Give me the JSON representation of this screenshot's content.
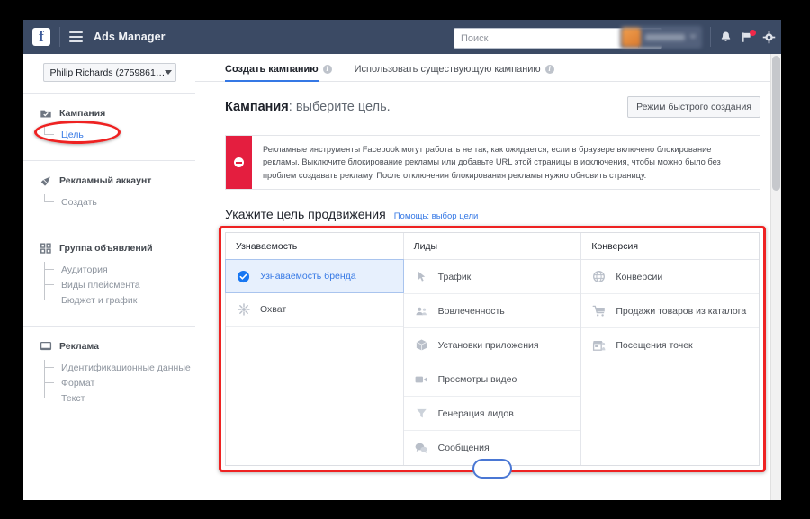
{
  "topbar": {
    "logo": "f",
    "menu_icon": "hamburger-icon",
    "app_title": "Ads Manager",
    "search": {
      "placeholder": "Поиск",
      "value": "",
      "icon": "search-icon"
    },
    "icons": [
      "bell-icon",
      "flag-icon",
      "gear-icon"
    ]
  },
  "sidebar": {
    "account_selector": {
      "label": "Philip Richards (2759861…",
      "icon": "chevron-down-icon"
    },
    "groups": [
      {
        "icon": "campaign-icon",
        "label": "Кампания",
        "items": [
          {
            "label": "Цель",
            "active": true,
            "highlighted": true
          }
        ]
      },
      {
        "icon": "megaphone-icon",
        "label": "Рекламный аккаунт",
        "items": [
          {
            "label": "Создать",
            "active": false,
            "highlighted": false
          }
        ]
      },
      {
        "icon": "adset-grid-icon",
        "label": "Группа объявлений",
        "items": [
          {
            "label": "Аудитория",
            "active": false,
            "highlighted": false
          },
          {
            "label": "Виды плейсмента",
            "active": false,
            "highlighted": false
          },
          {
            "label": "Бюджет и график",
            "active": false,
            "highlighted": false
          }
        ]
      },
      {
        "icon": "ad-monitor-icon",
        "label": "Реклама",
        "items": [
          {
            "label": "Идентификационные данные",
            "active": false,
            "highlighted": false
          },
          {
            "label": "Формат",
            "active": false,
            "highlighted": false
          },
          {
            "label": "Текст",
            "active": false,
            "highlighted": false
          }
        ]
      }
    ]
  },
  "main": {
    "tabs": [
      {
        "label": "Создать кампанию",
        "active": true,
        "info": "info-icon"
      },
      {
        "label": "Использовать существующую кампанию",
        "active": false,
        "info": "info-icon"
      }
    ],
    "heading": {
      "strong": "Кампания",
      "rest": ": выберите цель."
    },
    "quick_create_button": "Режим быстрого создания",
    "alert": {
      "icon": "error-circle-icon",
      "text": "Рекламные инструменты Facebook могут работать не так, как ожидается, если в браузере включено блокирование рекламы. Выключите блокирование рекламы или добавьте URL этой страницы в исключения, чтобы можно было без проблем создавать рекламу. После отключения блокирования рекламы нужно обновить страницу."
    },
    "section": {
      "title": "Укажите цель продвижения",
      "help_link": "Помощь: выбор цели"
    },
    "objectives": [
      {
        "header": "Узнаваемость",
        "items": [
          {
            "label": "Узнаваемость бренда",
            "icon": "check-circle-icon",
            "selected": true
          },
          {
            "label": "Охват",
            "icon": "reach-burst-icon",
            "selected": false
          }
        ]
      },
      {
        "header": "Лиды",
        "items": [
          {
            "label": "Трафик",
            "icon": "cursor-icon",
            "selected": false
          },
          {
            "label": "Вовлеченность",
            "icon": "people-icon",
            "selected": false
          },
          {
            "label": "Установки приложения",
            "icon": "cube-icon",
            "selected": false
          },
          {
            "label": "Просмотры видео",
            "icon": "video-camera-icon",
            "selected": false
          },
          {
            "label": "Генерация лидов",
            "icon": "funnel-icon",
            "selected": false
          },
          {
            "label": "Сообщения",
            "icon": "chat-bubbles-icon",
            "selected": false
          }
        ]
      },
      {
        "header": "Конверсия",
        "items": [
          {
            "label": "Конверсии",
            "icon": "globe-icon",
            "selected": false
          },
          {
            "label": "Продажи товаров из каталога",
            "icon": "shopping-cart-icon",
            "selected": false
          },
          {
            "label": "Посещения точек",
            "icon": "storefront-icon",
            "selected": false
          }
        ]
      }
    ]
  },
  "colors": {
    "topbar": "#3b4a64",
    "accent": "#3578e5",
    "alert": "#e41e3f",
    "annotation": "#ee2222",
    "selected_row_bg": "#e7f0fd"
  }
}
